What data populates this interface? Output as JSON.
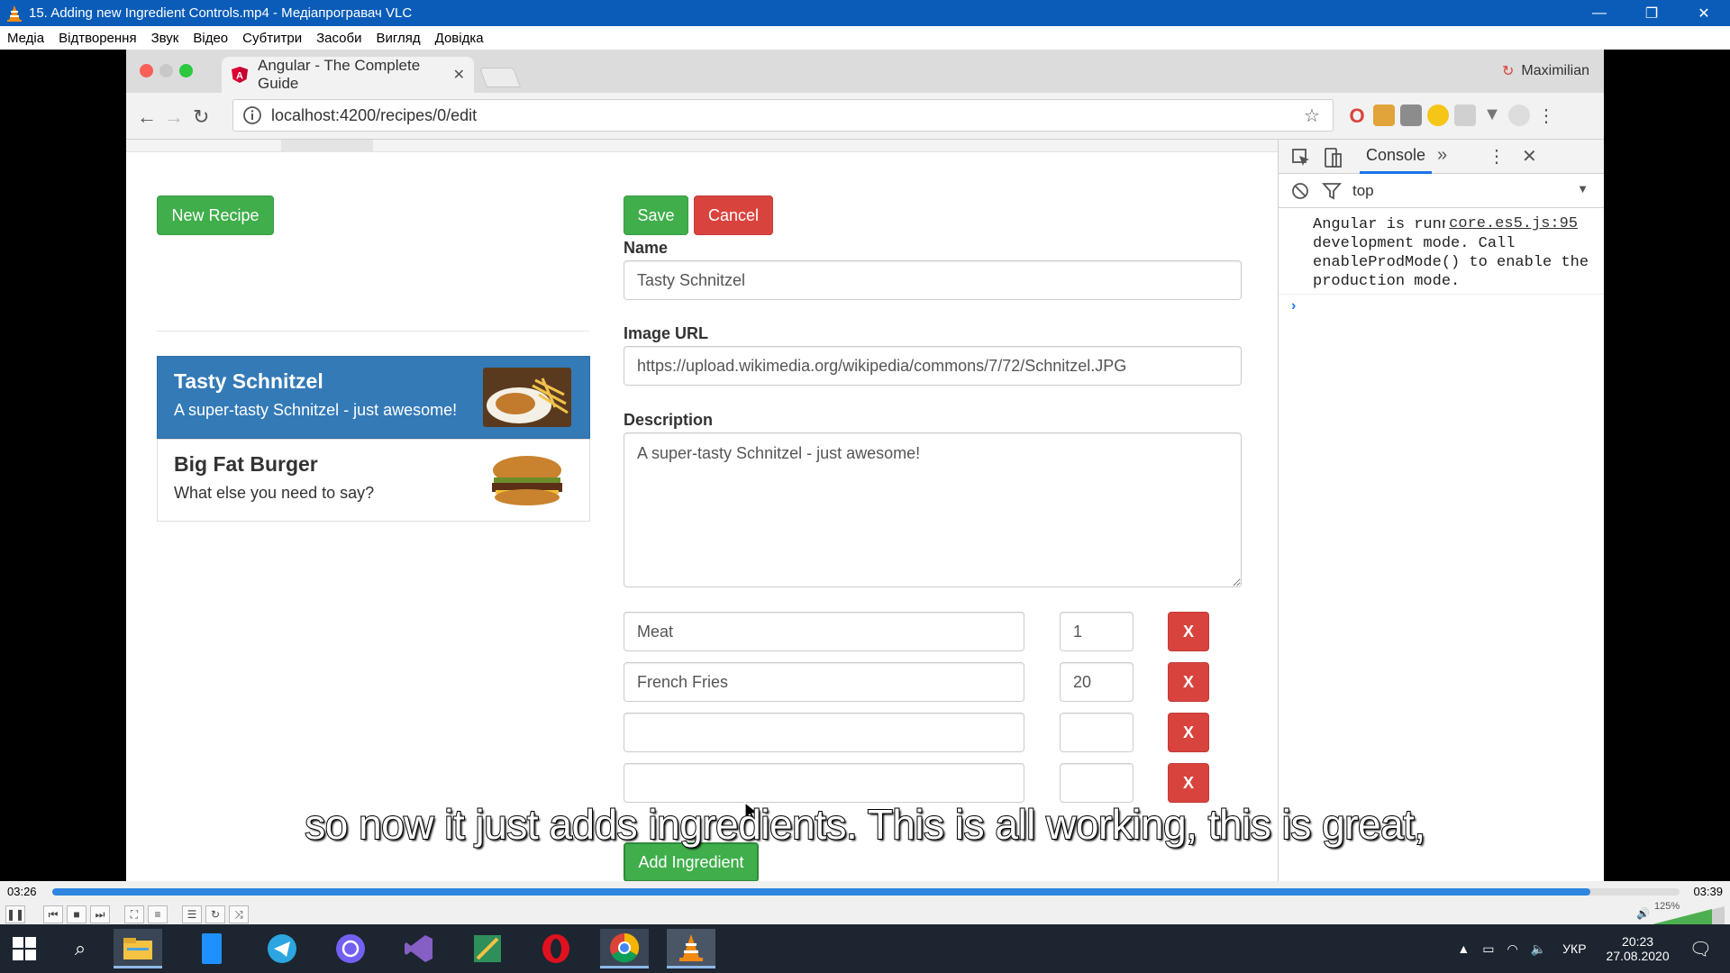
{
  "vlc": {
    "title": "15. Adding new Ingredient Controls.mp4 - Медіапрогравач VLC",
    "menu": [
      "Медіа",
      "Відтворення",
      "Звук",
      "Відео",
      "Субтитри",
      "Засоби",
      "Вигляд",
      "Довідка"
    ],
    "time_elapsed": "03:26",
    "time_total": "03:39",
    "progress": 0.945,
    "volume": "125%",
    "subtitle": "so now it just adds ingredients. This is all working, this is great,"
  },
  "browser": {
    "tab_title": "Angular - The Complete Guide",
    "profile": "Maximilian",
    "url": "localhost:4200/recipes/0/edit"
  },
  "app": {
    "new_recipe_label": "New Recipe",
    "save_label": "Save",
    "cancel_label": "Cancel",
    "recipes": [
      {
        "name": "Tasty Schnitzel",
        "description": "A super-tasty Schnitzel - just awesome!",
        "selected": true
      },
      {
        "name": "Big Fat Burger",
        "description": "What else you need to say?",
        "selected": false
      }
    ],
    "form": {
      "name_label": "Name",
      "name_value": "Tasty Schnitzel",
      "image_label": "Image URL",
      "image_value": "https://upload.wikimedia.org/wikipedia/commons/7/72/Schnitzel.JPG",
      "description_label": "Description",
      "description_value": "A super-tasty Schnitzel - just awesome!"
    },
    "ingredients": [
      {
        "name": "Meat",
        "amount": "1"
      },
      {
        "name": "French Fries",
        "amount": "20"
      },
      {
        "name": "",
        "amount": ""
      },
      {
        "name": "",
        "amount": ""
      }
    ],
    "remove_label": "X",
    "add_ingredient_label": "Add Ingredient"
  },
  "devtools": {
    "tab": "Console",
    "context": "top",
    "message": "Angular is running in the development mode. Call enableProdMode() to enable the production mode.",
    "source": "core.es5.js:95"
  },
  "taskbar": {
    "language": "УКР",
    "time": "20:23",
    "date": "27.08.2020"
  },
  "colors": {
    "vlc_title": "#0a5cb8",
    "success": "#3fae4b",
    "danger": "#d9433e",
    "primary": "#337ab7"
  }
}
